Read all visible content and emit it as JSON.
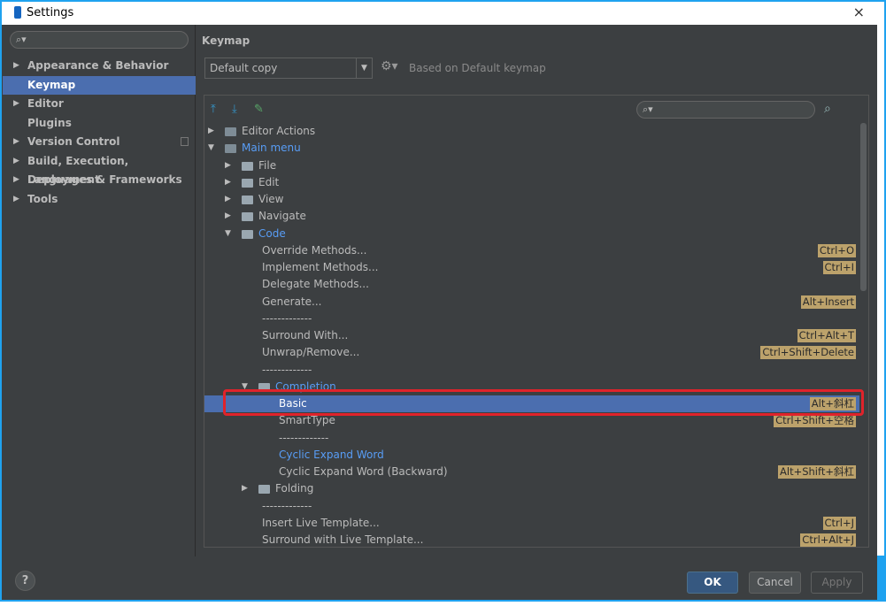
{
  "window": {
    "title": "Settings",
    "close_glyph": "×"
  },
  "left": {
    "search_placeholder": "",
    "items": [
      {
        "label": "Appearance & Behavior",
        "expandable": true
      },
      {
        "label": "Keymap",
        "expandable": false,
        "selected": true
      },
      {
        "label": "Editor",
        "expandable": true
      },
      {
        "label": "Plugins",
        "expandable": false
      },
      {
        "label": "Version Control",
        "expandable": true
      },
      {
        "label": "Build, Execution, Deployment",
        "expandable": true
      },
      {
        "label": "Languages & Frameworks",
        "expandable": true
      },
      {
        "label": "Tools",
        "expandable": true
      }
    ]
  },
  "keymap": {
    "section_title": "Keymap",
    "selected_keymap": "Default copy",
    "based_on": "Based on Default keymap",
    "tree_search_placeholder": ""
  },
  "tree": [
    {
      "label": "Editor Actions",
      "indent": 0,
      "arrow": "right",
      "icon": "menu-folder",
      "shortcut": ""
    },
    {
      "label": "Main menu",
      "indent": 0,
      "arrow": "down",
      "icon": "menu-folder",
      "blue": true,
      "shortcut": ""
    },
    {
      "label": "File",
      "indent": 1,
      "arrow": "right",
      "icon": "folder",
      "shortcut": ""
    },
    {
      "label": "Edit",
      "indent": 1,
      "arrow": "right",
      "icon": "folder",
      "shortcut": ""
    },
    {
      "label": "View",
      "indent": 1,
      "arrow": "right",
      "icon": "folder",
      "shortcut": ""
    },
    {
      "label": "Navigate",
      "indent": 1,
      "arrow": "right",
      "icon": "folder",
      "shortcut": ""
    },
    {
      "label": "Code",
      "indent": 1,
      "arrow": "down",
      "icon": "folder",
      "blue": true,
      "shortcut": ""
    },
    {
      "label": "Override Methods...",
      "indent": 2,
      "arrow": "",
      "icon": "",
      "shortcut": "Ctrl+O"
    },
    {
      "label": "Implement Methods...",
      "indent": 2,
      "arrow": "",
      "icon": "",
      "shortcut": "Ctrl+I"
    },
    {
      "label": "Delegate Methods...",
      "indent": 2,
      "arrow": "",
      "icon": "",
      "shortcut": ""
    },
    {
      "label": "Generate...",
      "indent": 2,
      "arrow": "",
      "icon": "",
      "shortcut": "Alt+Insert"
    },
    {
      "label": "-------------",
      "indent": 2,
      "arrow": "",
      "icon": "",
      "shortcut": ""
    },
    {
      "label": "Surround With...",
      "indent": 2,
      "arrow": "",
      "icon": "",
      "shortcut": "Ctrl+Alt+T"
    },
    {
      "label": "Unwrap/Remove...",
      "indent": 2,
      "arrow": "",
      "icon": "",
      "shortcut": "Ctrl+Shift+Delete"
    },
    {
      "label": "-------------",
      "indent": 2,
      "arrow": "",
      "icon": "",
      "shortcut": ""
    },
    {
      "label": "Completion",
      "indent": 2,
      "arrow": "down",
      "icon": "folder",
      "blue": true,
      "shortcut": ""
    },
    {
      "label": "Basic",
      "indent": 3,
      "arrow": "",
      "icon": "",
      "shortcut": "Alt+斜杠",
      "selected": true
    },
    {
      "label": "SmartType",
      "indent": 3,
      "arrow": "",
      "icon": "",
      "shortcut": "Ctrl+Shift+空格"
    },
    {
      "label": "-------------",
      "indent": 3,
      "arrow": "",
      "icon": "",
      "shortcut": ""
    },
    {
      "label": "Cyclic Expand Word",
      "indent": 3,
      "arrow": "",
      "icon": "",
      "blue": true,
      "shortcut": ""
    },
    {
      "label": "Cyclic Expand Word (Backward)",
      "indent": 3,
      "arrow": "",
      "icon": "",
      "shortcut": "Alt+Shift+斜杠"
    },
    {
      "label": "Folding",
      "indent": 2,
      "arrow": "right",
      "icon": "folder",
      "shortcut": ""
    },
    {
      "label": "-------------",
      "indent": 2,
      "arrow": "",
      "icon": "",
      "shortcut": ""
    },
    {
      "label": "Insert Live Template...",
      "indent": 2,
      "arrow": "",
      "icon": "",
      "shortcut": "Ctrl+J"
    },
    {
      "label": "Surround with Live Template...",
      "indent": 2,
      "arrow": "",
      "icon": "",
      "shortcut": "Ctrl+Alt+J"
    }
  ],
  "buttons": {
    "help": "?",
    "ok": "OK",
    "cancel": "Cancel",
    "apply": "Apply"
  },
  "colors": {
    "accent": "#4b6eaf",
    "shortcut_bg": "#bca26b",
    "highlight": "#e0232b",
    "link_blue": "#589df6"
  }
}
